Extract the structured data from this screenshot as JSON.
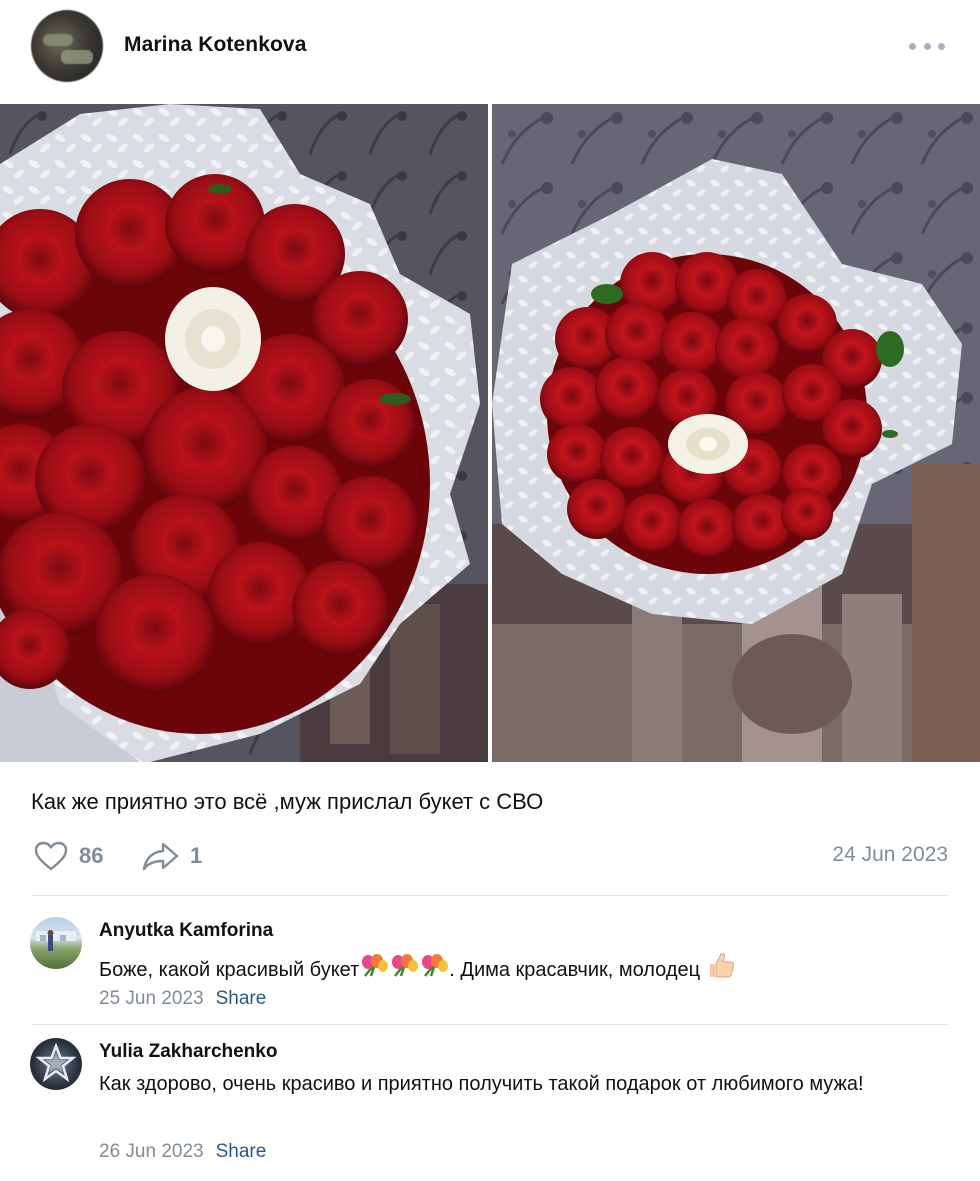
{
  "post": {
    "author": "Marina Kotenkova",
    "more_icon": "more-horizontal-icon",
    "photos": [
      {
        "subject": "bouquet of red roses with one white rose"
      },
      {
        "subject": "bouquet of red roses with one white rose"
      }
    ],
    "caption": "Как же приятно это всё ,муж прислал букет с СВО",
    "likes": "86",
    "shares": "1",
    "date": "24 Jun 2023"
  },
  "comments": [
    {
      "author": "Anyutka Kamforina",
      "text_before_emoji": "Боже, какой красивый букет",
      "text_after_emoji": ". Дима красавчик, молодец",
      "date": "25 Jun 2023",
      "share_label": "Share"
    },
    {
      "author": "Yulia Zakharchenko",
      "text": "Как здорово, очень красиво и приятно получить такой подарок от любимого мужа!",
      "date": "26 Jun 2023",
      "share_label": "Share"
    }
  ],
  "colors": {
    "muted": "#818c99",
    "link": "#2a5885",
    "divider": "#e1e3e6"
  }
}
